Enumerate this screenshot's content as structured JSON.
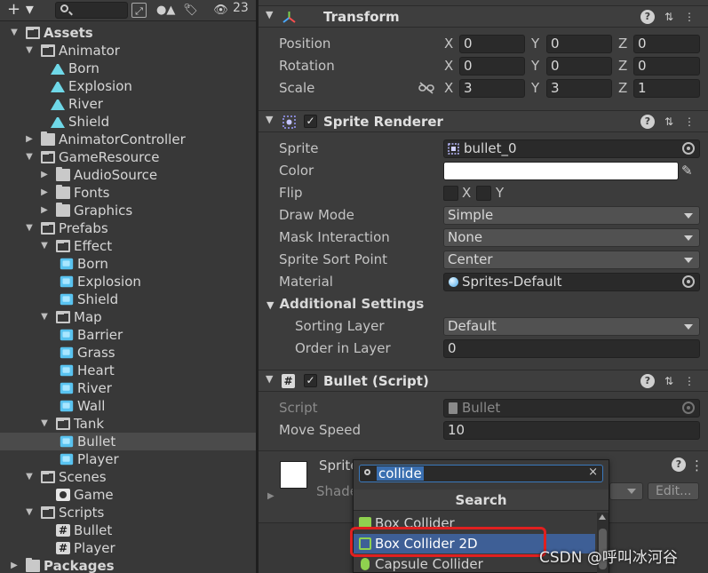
{
  "toolbar": {
    "add_label": "+",
    "hidden_count": "23"
  },
  "tree": [
    {
      "label": "Assets",
      "depth": 0,
      "arrow": "▼",
      "icon": "folder-open",
      "bold": true
    },
    {
      "label": "Animator",
      "depth": 1,
      "arrow": "▼",
      "icon": "folder-open"
    },
    {
      "label": "Born",
      "depth": 3,
      "arrow": "",
      "icon": "anim"
    },
    {
      "label": "Explosion",
      "depth": 3,
      "arrow": "",
      "icon": "anim"
    },
    {
      "label": "River",
      "depth": 3,
      "arrow": "",
      "icon": "anim"
    },
    {
      "label": "Shield",
      "depth": 3,
      "arrow": "",
      "icon": "anim"
    },
    {
      "label": "AnimatorController",
      "depth": 1,
      "arrow": "▶",
      "icon": "folder"
    },
    {
      "label": "GameResource",
      "depth": 1,
      "arrow": "▼",
      "icon": "folder-open"
    },
    {
      "label": "AudioSource",
      "depth": 2,
      "arrow": "▶",
      "icon": "folder"
    },
    {
      "label": "Fonts",
      "depth": 2,
      "arrow": "▶",
      "icon": "folder"
    },
    {
      "label": "Graphics",
      "depth": 2,
      "arrow": "▶",
      "icon": "folder"
    },
    {
      "label": "Prefabs",
      "depth": 1,
      "arrow": "▼",
      "icon": "folder-open"
    },
    {
      "label": "Effect",
      "depth": 2,
      "arrow": "▼",
      "icon": "folder-open"
    },
    {
      "label": "Born",
      "depth": 4,
      "arrow": "",
      "icon": "prefab"
    },
    {
      "label": "Explosion",
      "depth": 4,
      "arrow": "",
      "icon": "prefab"
    },
    {
      "label": "Shield",
      "depth": 4,
      "arrow": "",
      "icon": "prefab"
    },
    {
      "label": "Map",
      "depth": 2,
      "arrow": "▼",
      "icon": "folder-open"
    },
    {
      "label": "Barrier",
      "depth": 4,
      "arrow": "",
      "icon": "prefab"
    },
    {
      "label": "Grass",
      "depth": 4,
      "arrow": "",
      "icon": "prefab"
    },
    {
      "label": "Heart",
      "depth": 4,
      "arrow": "",
      "icon": "prefab"
    },
    {
      "label": "River",
      "depth": 4,
      "arrow": "",
      "icon": "prefab"
    },
    {
      "label": "Wall",
      "depth": 4,
      "arrow": "",
      "icon": "prefab"
    },
    {
      "label": "Tank",
      "depth": 2,
      "arrow": "▼",
      "icon": "folder-open"
    },
    {
      "label": "Bullet",
      "depth": 4,
      "arrow": "",
      "icon": "prefab",
      "selected": true
    },
    {
      "label": "Player",
      "depth": 4,
      "arrow": "",
      "icon": "prefab"
    },
    {
      "label": "Scenes",
      "depth": 1,
      "arrow": "▼",
      "icon": "folder-open"
    },
    {
      "label": "Game",
      "depth": 3,
      "arrow": "",
      "icon": "scene"
    },
    {
      "label": "Scripts",
      "depth": 1,
      "arrow": "▼",
      "icon": "folder-open"
    },
    {
      "label": "Bullet",
      "depth": 3,
      "arrow": "",
      "icon": "script"
    },
    {
      "label": "Player",
      "depth": 3,
      "arrow": "",
      "icon": "script"
    },
    {
      "label": "Packages",
      "depth": 0,
      "arrow": "▶",
      "icon": "folder",
      "bold": true
    }
  ],
  "transform": {
    "title": "Transform",
    "position": {
      "label": "Position",
      "x": "0",
      "y": "0",
      "z": "0"
    },
    "rotation": {
      "label": "Rotation",
      "x": "0",
      "y": "0",
      "z": "0"
    },
    "scale": {
      "label": "Scale",
      "x": "3",
      "y": "3",
      "z": "1"
    },
    "axis": {
      "x": "X",
      "y": "Y",
      "z": "Z"
    }
  },
  "sprite_renderer": {
    "title": "Sprite Renderer",
    "sprite_label": "Sprite",
    "sprite_value": "bullet_0",
    "color_label": "Color",
    "color_value": "#ffffff",
    "flip_label": "Flip",
    "flip_x": "X",
    "flip_y": "Y",
    "draw_mode_label": "Draw Mode",
    "draw_mode_value": "Simple",
    "mask_label": "Mask Interaction",
    "mask_value": "None",
    "sort_point_label": "Sprite Sort Point",
    "sort_point_value": "Center",
    "material_label": "Material",
    "material_value": "Sprites-Default",
    "additional_label": "Additional Settings",
    "sorting_layer_label": "Sorting Layer",
    "sorting_layer_value": "Default",
    "order_label": "Order in Layer",
    "order_value": "0"
  },
  "bullet_script": {
    "title": "Bullet (Script)",
    "script_label": "Script",
    "script_value": "Bullet",
    "speed_label": "Move Speed",
    "speed_value": "10"
  },
  "material_section": {
    "name_partial": "Sprite",
    "shader_partial": "Shade",
    "edit_label": "Edit..."
  },
  "popup": {
    "search_value": "collide",
    "header": "Search",
    "items": [
      {
        "label": "Box Collider",
        "icon_color": "#8fd14f"
      },
      {
        "label": "Box Collider 2D",
        "icon_color": "#8fd14f",
        "highlighted": true
      },
      {
        "label": "Capsule Collider",
        "icon_color": "#8fd14f"
      }
    ]
  },
  "watermark": "CSDN @呼叫冰河谷",
  "colors": {
    "selection": "#4b4b4b",
    "highlight": "#3e5f96",
    "annotation": "#e02020",
    "prefab": "#59c3f0"
  }
}
